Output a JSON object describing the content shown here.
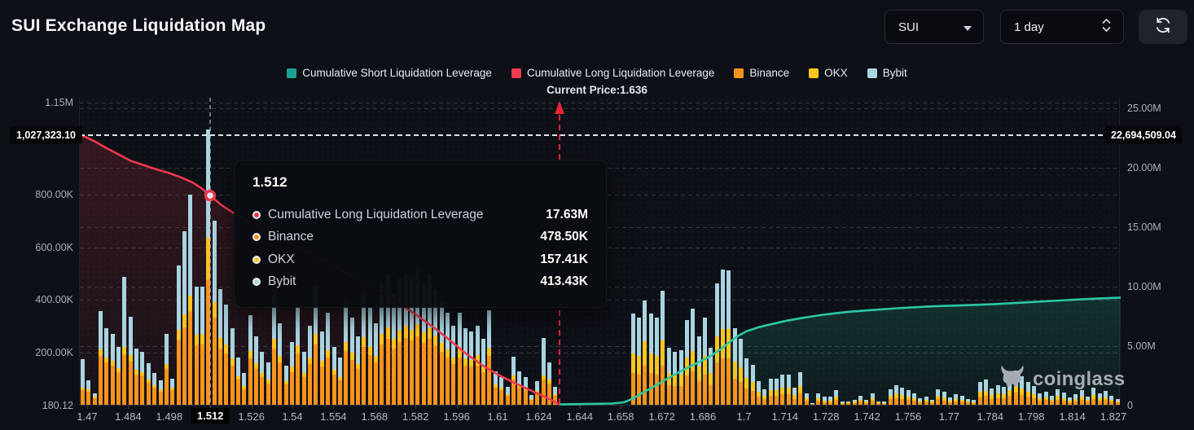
{
  "header": {
    "title": "SUI Exchange Liquidation Map",
    "symbol": "SUI",
    "interval": "1 day"
  },
  "legend": [
    {
      "label": "Cumulative Short Liquidation Leverage",
      "color": "#1ba193"
    },
    {
      "label": "Cumulative Long Liquidation Leverage",
      "color": "#ef3a4f"
    },
    {
      "label": "Binance",
      "color": "#f7941c"
    },
    {
      "label": "OKX",
      "color": "#fdc51f"
    },
    {
      "label": "Bybit",
      "color": "#a9d4e0"
    }
  ],
  "annotations": {
    "current_price_label": "Current Price:1.636"
  },
  "left_axis": {
    "marked_value": "1,027,323.10",
    "ticks": [
      {
        "label": "1.15M",
        "k": 1150
      },
      {
        "label": "800.00K",
        "k": 800
      },
      {
        "label": "600.00K",
        "k": 600
      },
      {
        "label": "400.00K",
        "k": 400
      },
      {
        "label": "200.00K",
        "k": 200
      },
      {
        "label": "180.12",
        "k": 0
      }
    ]
  },
  "right_axis": {
    "marked_value": "22,694,509.04",
    "ticks": [
      {
        "label": "25.00M",
        "m": 25
      },
      {
        "label": "20.00M",
        "m": 20
      },
      {
        "label": "15.00M",
        "m": 15
      },
      {
        "label": "10.00M",
        "m": 10
      },
      {
        "label": "5.00M",
        "m": 5
      },
      {
        "label": "0",
        "m": 0
      }
    ]
  },
  "x_axis": {
    "labels": [
      "1.47",
      "1.484",
      "1.498",
      "1.512",
      "1.526",
      "1.54",
      "1.554",
      "1.568",
      "1.582",
      "1.596",
      "1.61",
      "1.624",
      "1.644",
      "1.658",
      "1.672",
      "1.686",
      "1.7",
      "1.714",
      "1.728",
      "1.742",
      "1.756",
      "1.77",
      "1.784",
      "1.798",
      "1.814",
      "1.827"
    ],
    "highlighted": "1.512"
  },
  "tooltip": {
    "title": "1.512",
    "rows": [
      {
        "label": "Cumulative Long Liquidation Leverage",
        "value": "17.63M",
        "color": "#ef3a4f"
      },
      {
        "label": "Binance",
        "value": "478.50K",
        "color": "#f7941c"
      },
      {
        "label": "OKX",
        "value": "157.41K",
        "color": "#fdc51f"
      },
      {
        "label": "Bybit",
        "value": "413.43K",
        "color": "#a9d4e0"
      }
    ]
  },
  "watermark": "coinglass",
  "chart_data": {
    "type": "bar+line",
    "title": "SUI Exchange Liquidation Map",
    "current_price": {
      "price": 1.636,
      "frac": 0.461
    },
    "reference_level_m": 22.6945,
    "reference_level_left": 1027.32,
    "marker": {
      "frac": 0.1252,
      "value_m": 17.63,
      "x_label": "1.512"
    },
    "right_axis_range_m": [
      0,
      25.86
    ],
    "left_axis_range_k": [
      0,
      1168
    ],
    "bar_series": [
      "Binance",
      "OKX",
      "Bybit"
    ],
    "bar_colors": [
      "#f7941c",
      "#fdc51f",
      "#a9d4e0"
    ],
    "bar_unit": "thousands, left axis",
    "bars": [
      [
        55,
        10,
        110
      ],
      [
        50,
        8,
        35
      ],
      [
        25,
        5,
        15
      ],
      [
        185,
        25,
        145
      ],
      [
        160,
        20,
        110
      ],
      [
        150,
        18,
        100
      ],
      [
        125,
        15,
        80
      ],
      [
        190,
        30,
        265
      ],
      [
        165,
        25,
        145
      ],
      [
        115,
        18,
        80
      ],
      [
        110,
        15,
        75
      ],
      [
        85,
        12,
        60
      ],
      [
        65,
        10,
        45
      ],
      [
        50,
        8,
        35
      ],
      [
        135,
        20,
        115
      ],
      [
        55,
        10,
        35
      ],
      [
        245,
        40,
        245
      ],
      [
        295,
        50,
        315
      ],
      [
        355,
        60,
        385
      ],
      [
        225,
        40,
        185
      ],
      [
        230,
        40,
        180
      ],
      [
        478,
        157,
        413
      ],
      [
        330,
        60,
        310
      ],
      [
        215,
        40,
        185
      ],
      [
        195,
        35,
        150
      ],
      [
        150,
        25,
        115
      ],
      [
        95,
        15,
        70
      ],
      [
        60,
        10,
        50
      ],
      [
        175,
        30,
        135
      ],
      [
        135,
        22,
        103
      ],
      [
        105,
        17,
        78
      ],
      [
        82,
        13,
        65
      ],
      [
        215,
        35,
        170
      ],
      [
        160,
        26,
        124
      ],
      [
        78,
        12,
        60
      ],
      [
        125,
        20,
        95
      ],
      [
        195,
        32,
        153
      ],
      [
        105,
        17,
        78
      ],
      [
        155,
        25,
        120
      ],
      [
        230,
        38,
        182
      ],
      [
        145,
        23,
        112
      ],
      [
        180,
        29,
        141
      ],
      [
        115,
        18,
        87
      ],
      [
        92,
        15,
        73
      ],
      [
        205,
        33,
        162
      ],
      [
        170,
        27,
        133
      ],
      [
        135,
        21,
        104
      ],
      [
        220,
        36,
        174
      ],
      [
        190,
        31,
        149
      ],
      [
        160,
        26,
        124
      ],
      [
        230,
        40,
        190
      ],
      [
        250,
        45,
        205
      ],
      [
        215,
        35,
        170
      ],
      [
        240,
        42,
        198
      ],
      [
        255,
        45,
        200
      ],
      [
        245,
        40,
        195
      ],
      [
        260,
        45,
        215
      ],
      [
        235,
        40,
        185
      ],
      [
        250,
        42,
        208
      ],
      [
        225,
        38,
        177
      ],
      [
        200,
        34,
        156
      ],
      [
        180,
        30,
        140
      ],
      [
        155,
        26,
        119
      ],
      [
        180,
        30,
        140
      ],
      [
        150,
        25,
        115
      ],
      [
        145,
        24,
        111
      ],
      [
        150,
        38,
        112
      ],
      [
        125,
        21,
        104
      ],
      [
        185,
        31,
        144
      ],
      [
        65,
        11,
        51
      ],
      [
        55,
        9,
        42
      ],
      [
        35,
        6,
        27
      ],
      [
        95,
        16,
        72
      ],
      [
        65,
        11,
        51
      ],
      [
        55,
        9,
        42
      ],
      [
        19,
        3,
        15
      ],
      [
        46,
        8,
        36
      ],
      [
        95,
        16,
        143
      ],
      [
        82,
        14,
        65
      ],
      [
        35,
        6,
        27
      ],
      [
        0,
        0,
        0
      ],
      [
        0,
        0,
        0
      ],
      [
        0,
        0,
        0
      ],
      [
        0,
        0,
        0
      ],
      [
        0,
        0,
        0
      ],
      [
        0,
        0,
        0
      ],
      [
        0,
        0,
        0
      ],
      [
        0,
        0,
        0
      ],
      [
        0,
        0,
        0
      ],
      [
        0,
        0,
        0
      ],
      [
        0,
        0,
        0
      ],
      [
        0,
        0,
        0
      ],
      [
        120,
        75,
        152
      ],
      [
        115,
        72,
        144
      ],
      [
        150,
        90,
        157
      ],
      [
        120,
        75,
        152
      ],
      [
        115,
        70,
        147
      ],
      [
        150,
        95,
        189
      ],
      [
        75,
        47,
        95
      ],
      [
        70,
        44,
        88
      ],
      [
        72,
        45,
        90
      ],
      [
        111,
        70,
        141
      ],
      [
        127,
        79,
        160
      ],
      [
        90,
        56,
        114
      ],
      [
        115,
        72,
        145
      ],
      [
        75,
        47,
        95
      ],
      [
        160,
        100,
        202
      ],
      [
        178,
        111,
        226
      ],
      [
        177,
        110,
        225
      ],
      [
        100,
        63,
        128
      ],
      [
        87,
        54,
        109
      ],
      [
        62,
        39,
        76
      ],
      [
        53,
        33,
        66
      ],
      [
        31,
        20,
        39
      ],
      [
        21,
        13,
        25
      ],
      [
        34,
        22,
        43
      ],
      [
        34,
        22,
        43
      ],
      [
        40,
        25,
        50
      ],
      [
        40,
        25,
        50
      ],
      [
        23,
        14,
        28
      ],
      [
        43,
        27,
        54
      ],
      [
        15,
        9,
        19
      ],
      [
        2,
        1,
        3
      ],
      [
        15,
        9,
        19
      ],
      [
        10,
        7,
        13
      ],
      [
        10,
        7,
        13
      ],
      [
        19,
        12,
        24
      ],
      [
        4,
        2,
        5
      ],
      [
        5,
        3,
        6
      ],
      [
        7,
        4,
        8
      ],
      [
        12,
        8,
        15
      ],
      [
        7,
        4,
        9
      ],
      [
        16,
        10,
        19
      ],
      [
        5,
        3,
        6
      ],
      [
        4,
        2,
        5
      ],
      [
        21,
        13,
        26
      ],
      [
        26,
        16,
        33
      ],
      [
        23,
        14,
        28
      ],
      [
        19,
        12,
        24
      ],
      [
        16,
        10,
        19
      ],
      [
        9,
        5,
        11
      ],
      [
        11,
        7,
        14
      ],
      [
        7,
        4,
        9
      ],
      [
        21,
        13,
        26
      ],
      [
        17,
        11,
        22
      ],
      [
        10,
        6,
        12
      ],
      [
        14,
        9,
        17
      ],
      [
        12,
        8,
        15
      ],
      [
        8,
        5,
        10
      ],
      [
        6,
        4,
        8
      ],
      [
        30,
        19,
        37
      ],
      [
        33,
        21,
        41
      ],
      [
        22,
        14,
        27
      ],
      [
        26,
        16,
        33
      ],
      [
        24,
        15,
        30
      ],
      [
        35,
        22,
        44
      ],
      [
        45,
        28,
        56
      ],
      [
        38,
        24,
        47
      ],
      [
        30,
        19,
        37
      ],
      [
        25,
        16,
        31
      ],
      [
        15,
        9,
        19
      ],
      [
        18,
        11,
        22
      ],
      [
        12,
        8,
        15
      ],
      [
        20,
        13,
        25
      ],
      [
        16,
        10,
        20
      ],
      [
        10,
        6,
        12
      ],
      [
        14,
        9,
        17
      ],
      [
        19,
        12,
        24
      ],
      [
        11,
        7,
        14
      ],
      [
        22,
        14,
        28
      ],
      [
        15,
        9,
        19
      ],
      [
        18,
        11,
        23
      ],
      [
        12,
        8,
        15
      ],
      [
        8,
        5,
        10
      ]
    ],
    "long_line": {
      "name": "Cumulative Long Liquidation Leverage",
      "color": "#ef394e",
      "points": [
        [
          0,
          22.69
        ],
        [
          0.006,
          22.55
        ],
        [
          0.014,
          22.2
        ],
        [
          0.026,
          21.6
        ],
        [
          0.038,
          21.05
        ],
        [
          0.049,
          20.55
        ],
        [
          0.061,
          20.2
        ],
        [
          0.073,
          19.85
        ],
        [
          0.085,
          19.55
        ],
        [
          0.096,
          19.2
        ],
        [
          0.108,
          18.75
        ],
        [
          0.116,
          18.3
        ],
        [
          0.1252,
          17.63
        ],
        [
          0.135,
          16.9
        ],
        [
          0.147,
          16.2
        ],
        [
          0.159,
          15.6
        ],
        [
          0.175,
          14.9
        ],
        [
          0.19,
          14.2
        ],
        [
          0.21,
          13.3
        ],
        [
          0.229,
          12.4
        ],
        [
          0.249,
          11.5
        ],
        [
          0.268,
          10.5
        ],
        [
          0.288,
          9.5
        ],
        [
          0.308,
          8.5
        ],
        [
          0.323,
          7.6
        ],
        [
          0.339,
          6.6
        ],
        [
          0.355,
          5.5
        ],
        [
          0.37,
          4.4
        ],
        [
          0.386,
          3.4
        ],
        [
          0.401,
          2.6
        ],
        [
          0.417,
          1.9
        ],
        [
          0.433,
          1.25
        ],
        [
          0.447,
          0.7
        ],
        [
          0.456,
          0.3
        ],
        [
          0.461,
          0.06
        ]
      ]
    },
    "short_line": {
      "name": "Cumulative Short Liquidation Leverage",
      "color": "#2bc7a4",
      "points": [
        [
          0.461,
          0.06
        ],
        [
          0.472,
          0.08
        ],
        [
          0.491,
          0.11
        ],
        [
          0.511,
          0.14
        ],
        [
          0.523,
          0.25
        ],
        [
          0.53,
          0.5
        ],
        [
          0.538,
          0.9
        ],
        [
          0.546,
          1.3
        ],
        [
          0.554,
          1.7
        ],
        [
          0.562,
          2.1
        ],
        [
          0.57,
          2.5
        ],
        [
          0.577,
          2.85
        ],
        [
          0.585,
          3.2
        ],
        [
          0.593,
          3.55
        ],
        [
          0.601,
          3.9
        ],
        [
          0.609,
          4.3
        ],
        [
          0.617,
          4.8
        ],
        [
          0.624,
          5.3
        ],
        [
          0.632,
          5.8
        ],
        [
          0.64,
          6.2
        ],
        [
          0.652,
          6.55
        ],
        [
          0.664,
          6.8
        ],
        [
          0.679,
          7.1
        ],
        [
          0.695,
          7.35
        ],
        [
          0.714,
          7.6
        ],
        [
          0.738,
          7.85
        ],
        [
          0.761,
          8.0
        ],
        [
          0.785,
          8.15
        ],
        [
          0.816,
          8.3
        ],
        [
          0.847,
          8.4
        ],
        [
          0.879,
          8.5
        ],
        [
          0.91,
          8.65
        ],
        [
          0.941,
          8.8
        ],
        [
          0.973,
          8.95
        ],
        [
          1,
          9.05
        ]
      ]
    }
  }
}
